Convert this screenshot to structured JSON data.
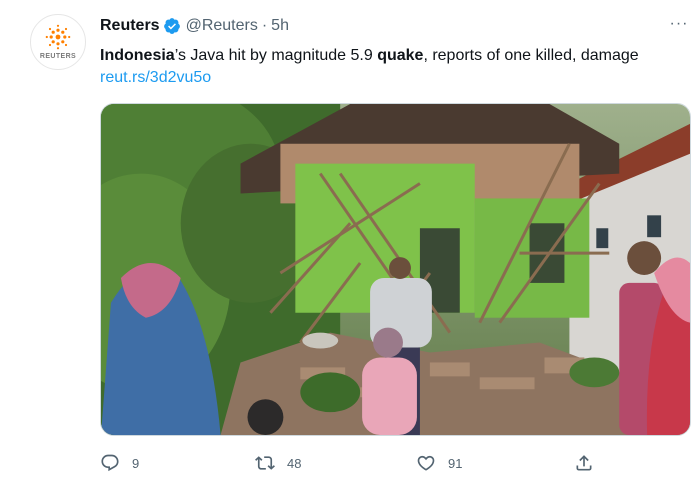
{
  "account": {
    "name": "Reuters",
    "handle": "@Reuters",
    "separator": "·",
    "time": "5h",
    "avatar_text": "REUTERS",
    "verified_color": "#1d9bf0"
  },
  "tweet": {
    "text_part1": "Indonesia",
    "text_part2": "’s Java hit by magnitude 5.9 ",
    "text_part3": "quake",
    "text_part4": ", reports of one killed, damage",
    "link": "reut.rs/3d2vu5o"
  },
  "media": {
    "description_icon": "photo-of-collapsed-house"
  },
  "actions": {
    "reply_count": "9",
    "retweet_count": "48",
    "like_count": "91"
  },
  "menu": {
    "more_label": "···"
  },
  "colors": {
    "accent": "#1d9bf0",
    "muted": "#536471",
    "text": "#0f1419",
    "brand": "#ff8000"
  }
}
